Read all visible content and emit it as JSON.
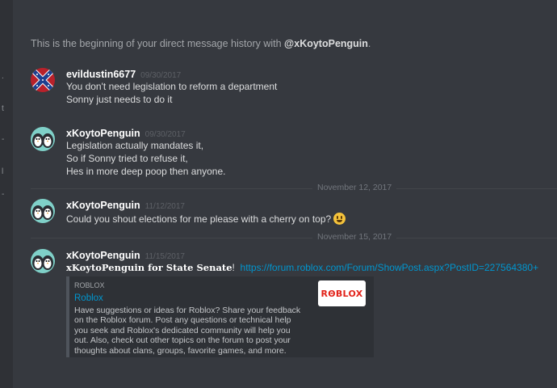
{
  "left_strip": {
    "glyphs": [
      ".",
      "t",
      "-",
      "l",
      "-"
    ]
  },
  "beginning": {
    "text": "This is the beginning of your direct message history with ",
    "user": "@xKoytoPenguin",
    "end": "."
  },
  "messages": [
    {
      "username": "evildustin6677",
      "timestamp": "09/30/2017",
      "avatar": "confederate-flag-avatar",
      "lines": [
        "You don't need legislation to reform a department",
        "Sonny just needs to do it"
      ]
    },
    {
      "username": "xKoytoPenguin",
      "timestamp": "09/30/2017",
      "avatar": "penguin-avatar",
      "lines": [
        "Legislation actually mandates it,",
        "So if Sonny tried to refuse it,",
        "Hes in more deep poop then anyone."
      ]
    },
    {
      "username": "xKoytoPenguin",
      "timestamp": "11/12/2017",
      "avatar": "penguin-avatar",
      "lines": [
        "Could you shout elections for me please with a cherry on top?"
      ],
      "emoji": "smiley-emoji"
    },
    {
      "username": "xKoytoPenguin",
      "timestamp": "11/15/2017",
      "avatar": "penguin-avatar",
      "post_title": "xKoytoPenguin for State Senate",
      "post_punct": "!",
      "link": "https://forum.roblox.com/Forum/ShowPost.aspx?PostID=227564380+"
    }
  ],
  "dividers": [
    "November 12, 2017",
    "November 15, 2017"
  ],
  "embed": {
    "provider": "ROBLOX",
    "title": "Roblox",
    "description": "Have suggestions or ideas for Roblox? Share your feedback on the Roblox forum. Post any questions or technical help you seek and Roblox's dedicated community will help you out. Also, check out other topics on the forum to post your thoughts about clans, groups, favorite games, and more.",
    "thumbnail_text": "RΘBLOX"
  },
  "colors": {
    "background": "#36393f",
    "link": "#0096cf",
    "username": "#ffffff",
    "timestamp": "#5d6066",
    "roblox_red": "#e2231a"
  }
}
